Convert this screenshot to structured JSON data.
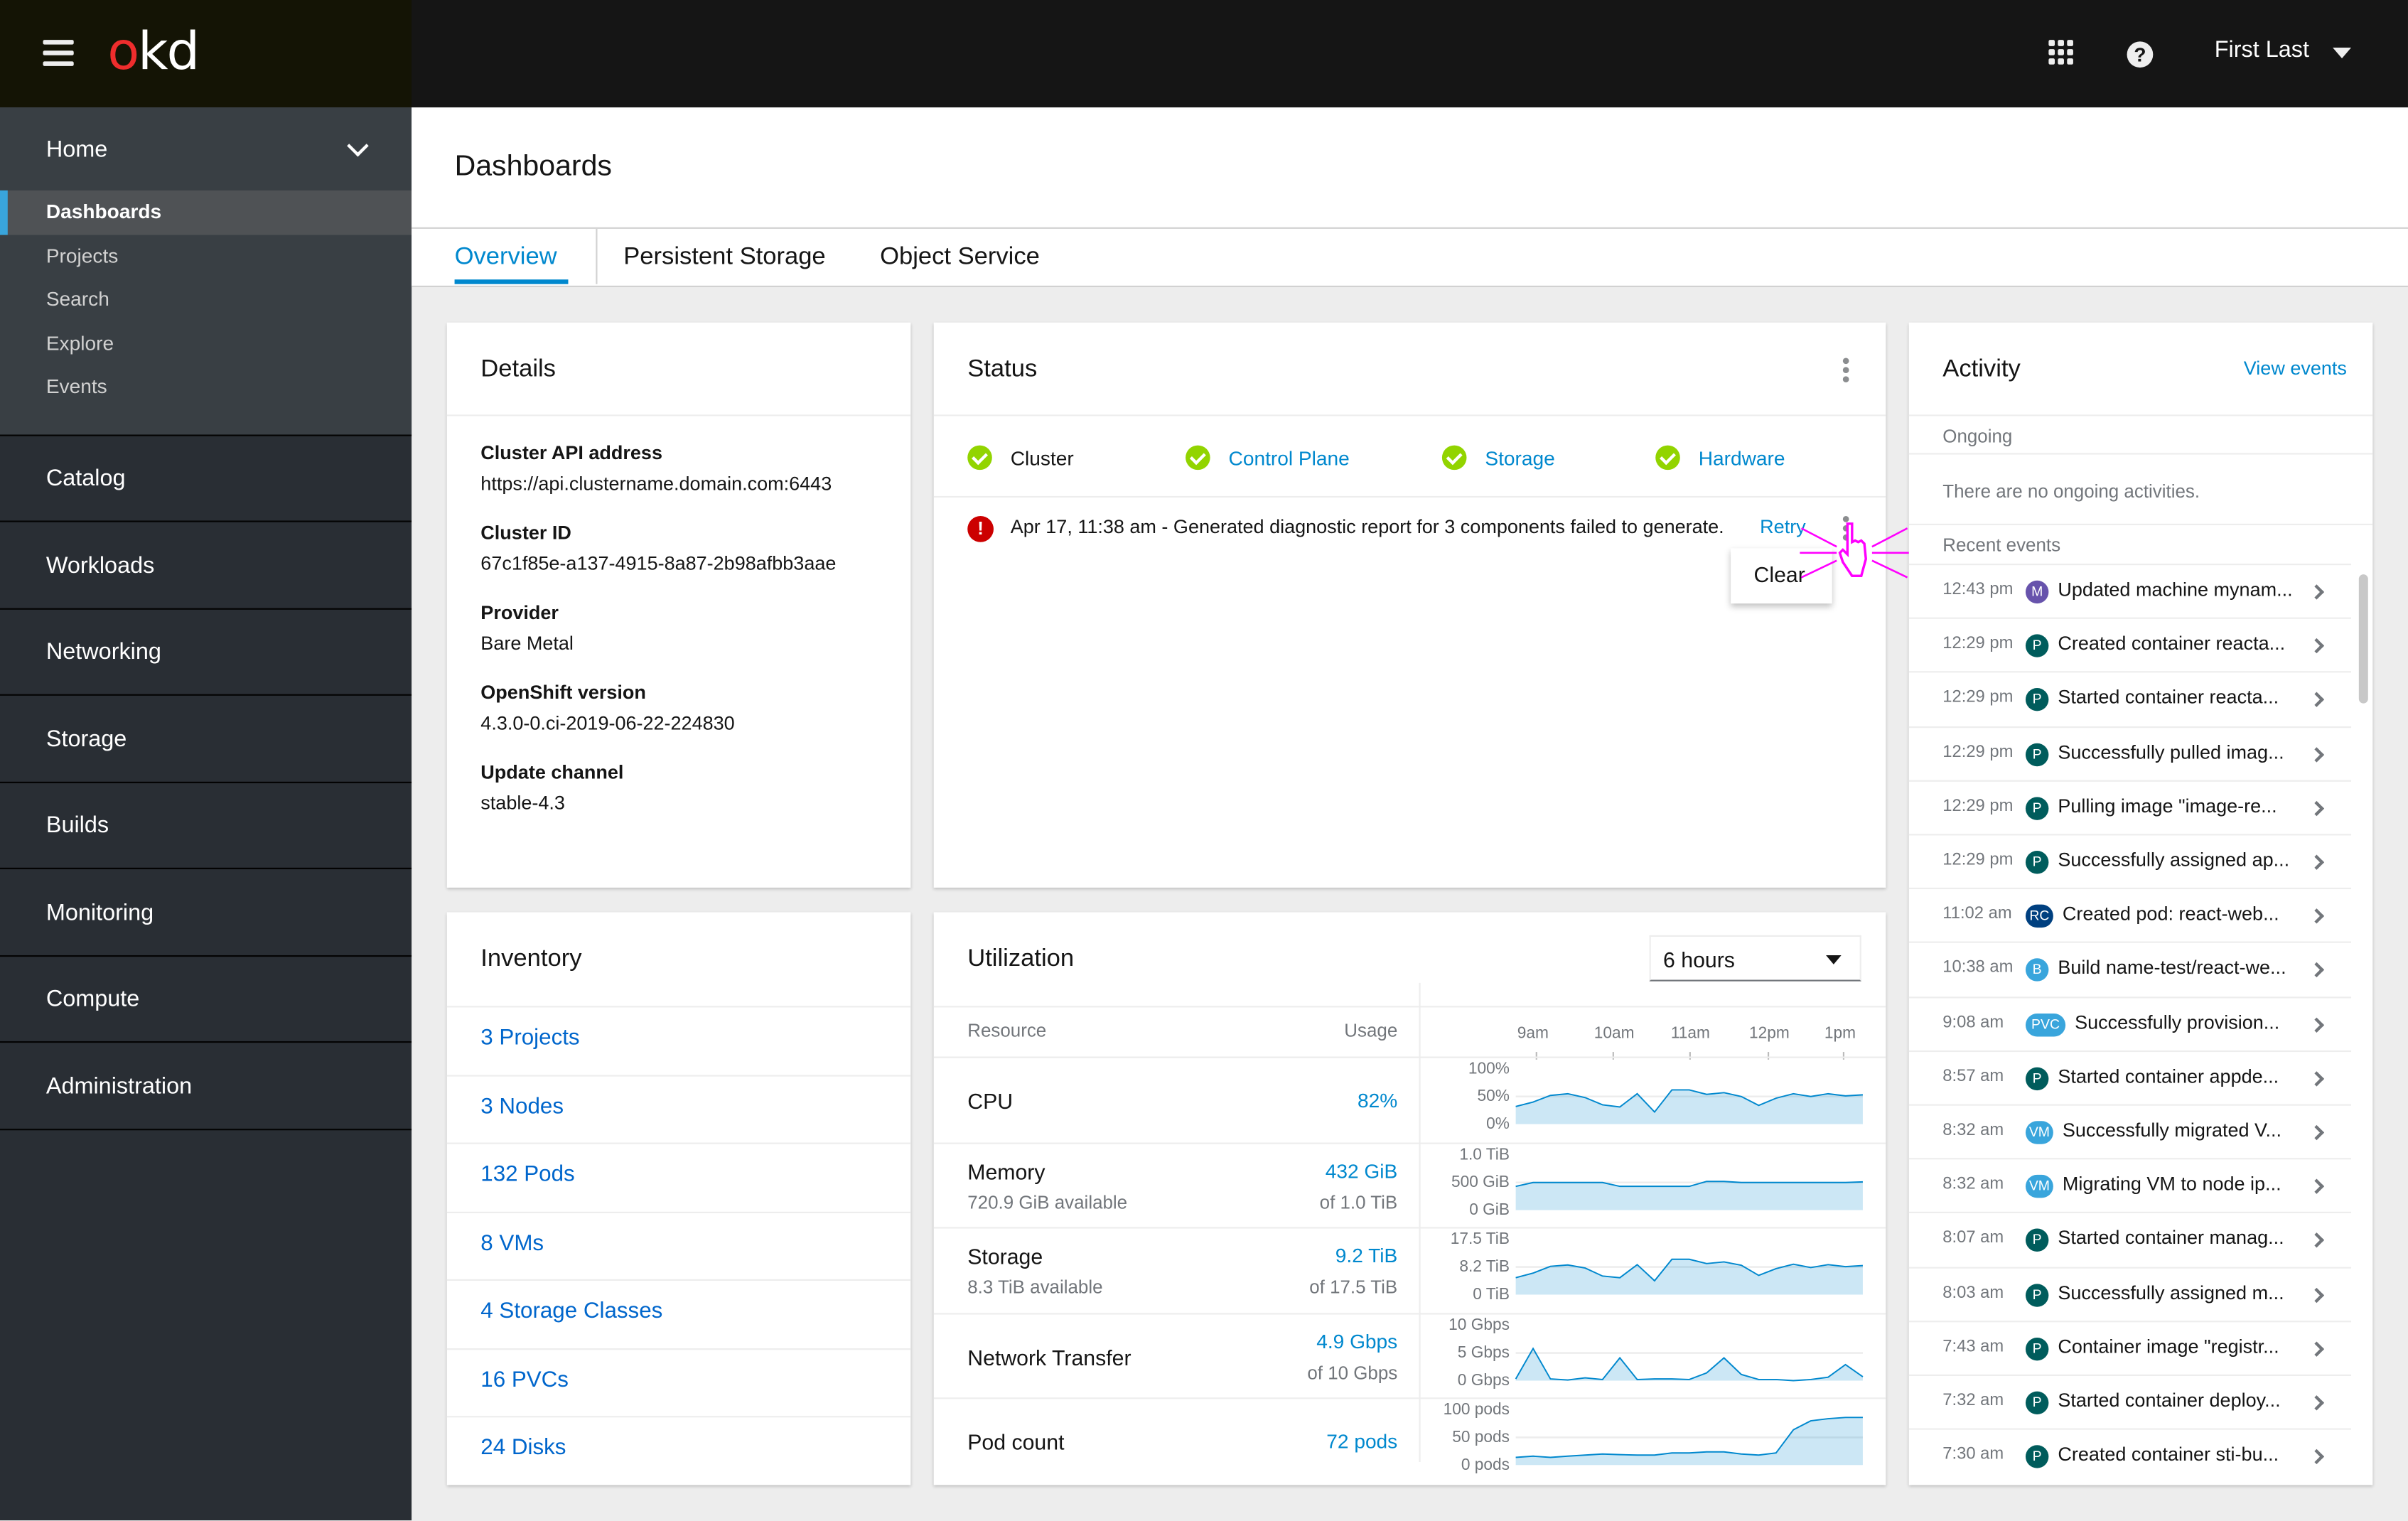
{
  "masthead": {
    "brand": {
      "o": "o",
      "kd": "kd"
    },
    "icons": [
      "hamburger-menu-icon",
      "app-launcher-grid-icon",
      "help-question-icon"
    ],
    "user_name": "First Last",
    "colors": {
      "logo_o": "#ee2d2d",
      "masthead_bg": "#151515"
    }
  },
  "sidebar": {
    "home": {
      "label": "Home",
      "expanded": true,
      "children": [
        {
          "label": "Dashboards",
          "active": true
        },
        {
          "label": "Projects"
        },
        {
          "label": "Search"
        },
        {
          "label": "Explore"
        },
        {
          "label": "Events"
        }
      ]
    },
    "items": [
      {
        "label": "Catalog"
      },
      {
        "label": "Workloads"
      },
      {
        "label": "Networking"
      },
      {
        "label": "Storage"
      },
      {
        "label": "Builds"
      },
      {
        "label": "Monitoring"
      },
      {
        "label": "Compute"
      },
      {
        "label": "Administration"
      }
    ]
  },
  "page": {
    "title": "Dashboards",
    "tabs": [
      {
        "label": "Overview",
        "active": true
      },
      {
        "label": "Persistent Storage"
      },
      {
        "label": "Object Service"
      }
    ]
  },
  "details": {
    "title": "Details",
    "fields": [
      {
        "label": "Cluster API address",
        "value": "https://api.clustername.domain.com:6443"
      },
      {
        "label": "Cluster ID",
        "value": "67c1f85e-a137-4915-8a87-2b98afbb3aae"
      },
      {
        "label": "Provider",
        "value": "Bare Metal"
      },
      {
        "label": "OpenShift version",
        "value": "4.3.0-0.ci-2019-06-22-224830"
      },
      {
        "label": "Update channel",
        "value": "stable-4.3"
      }
    ]
  },
  "status": {
    "title": "Status",
    "items": [
      {
        "label": "Cluster",
        "state": "ok",
        "link": false
      },
      {
        "label": "Control Plane",
        "state": "ok",
        "link": true
      },
      {
        "label": "Storage",
        "state": "ok",
        "link": true
      },
      {
        "label": "Hardware",
        "state": "ok",
        "link": true
      }
    ],
    "alert": {
      "severity": "error",
      "text": "Apr 17, 11:38 am - Generated diagnostic report for 3 components failed to generate.",
      "action": "Retry"
    },
    "menu": {
      "items": [
        "Clear"
      ]
    },
    "colors": {
      "ok": "#92d400",
      "error": "#cc0000",
      "link": "#0088ce"
    }
  },
  "activity": {
    "title": "Activity",
    "view_events": "View events",
    "ongoing_label": "Ongoing",
    "ongoing_empty": "There are no ongoing activities.",
    "recent_label": "Recent events",
    "events": [
      {
        "time": "12:43 pm",
        "badge": "M",
        "color": "#6753ac",
        "text": "Updated machine mynam..."
      },
      {
        "time": "12:29 pm",
        "badge": "P",
        "color": "#005c5c",
        "text": "Created container reacta..."
      },
      {
        "time": "12:29 pm",
        "badge": "P",
        "color": "#005c5c",
        "text": "Started container reacta..."
      },
      {
        "time": "12:29 pm",
        "badge": "P",
        "color": "#005c5c",
        "text": "Successfully pulled imag..."
      },
      {
        "time": "12:29 pm",
        "badge": "P",
        "color": "#005c5c",
        "text": "Pulling image \"image-re..."
      },
      {
        "time": "12:29 pm",
        "badge": "P",
        "color": "#005c5c",
        "text": "Successfully assigned ap..."
      },
      {
        "time": "11:02 am",
        "badge": "RC",
        "color": "#004080",
        "text": "Created pod: react-web..."
      },
      {
        "time": "10:38 am",
        "badge": "B",
        "color": "#39a5dc",
        "text": "Build name-test/react-we..."
      },
      {
        "time": "9:08 am",
        "badge": "PVC",
        "color": "#39a5dc",
        "text": "Successfully provision..."
      },
      {
        "time": "8:57 am",
        "badge": "P",
        "color": "#005c5c",
        "text": "Started container appde..."
      },
      {
        "time": "8:32 am",
        "badge": "VM",
        "color": "#39a5dc",
        "text": "Successfully migrated V..."
      },
      {
        "time": "8:32 am",
        "badge": "VM",
        "color": "#39a5dc",
        "text": "Migrating VM to node ip..."
      },
      {
        "time": "8:07 am",
        "badge": "P",
        "color": "#005c5c",
        "text": "Started container manag..."
      },
      {
        "time": "8:03 am",
        "badge": "P",
        "color": "#005c5c",
        "text": "Successfully assigned m..."
      },
      {
        "time": "7:43 am",
        "badge": "P",
        "color": "#005c5c",
        "text": "Container image \"registr..."
      },
      {
        "time": "7:32 am",
        "badge": "P",
        "color": "#005c5c",
        "text": "Started container deploy..."
      },
      {
        "time": "7:30 am",
        "badge": "P",
        "color": "#005c5c",
        "text": "Created container sti-bu..."
      }
    ]
  },
  "inventory": {
    "title": "Inventory",
    "items": [
      "3 Projects",
      "3 Nodes",
      "132 Pods",
      "8 VMs",
      "4 Storage Classes",
      "16 PVCs",
      "24 Disks"
    ]
  },
  "utilization": {
    "title": "Utilization",
    "range": "6 hours",
    "col_resource": "Resource",
    "col_usage": "Usage",
    "x_ticks": [
      "9am",
      "10am",
      "11am",
      "12pm",
      "1pm"
    ],
    "rows": [
      {
        "name": "CPU",
        "sub": "",
        "value": "82%",
        "of": ""
      },
      {
        "name": "Memory",
        "sub": "720.9 GiB available",
        "value": "432 GiB",
        "of": "of 1.0 TiB"
      },
      {
        "name": "Storage",
        "sub": "8.3 TiB available",
        "value": "9.2 TiB",
        "of": "of 17.5 TiB"
      },
      {
        "name": "Network Transfer",
        "sub": "",
        "value": "4.9 Gbps",
        "of": "of 10 Gbps"
      },
      {
        "name": "Pod count",
        "sub": "",
        "value": "72 pods",
        "of": ""
      }
    ]
  },
  "chart_data": [
    {
      "type": "area",
      "title": "CPU",
      "x": [
        "8:40am",
        "",
        "",
        "",
        "",
        "",
        "",
        "",
        "",
        "",
        "",
        "",
        "",
        "",
        "",
        "",
        "",
        "",
        "",
        "",
        "1:10pm"
      ],
      "y_ticks": [
        "100%",
        "50%",
        "0%"
      ],
      "ylim": [
        0,
        100
      ],
      "grid_line": 50,
      "values": [
        32,
        40,
        52,
        55,
        48,
        35,
        31,
        55,
        22,
        62,
        62,
        54,
        57,
        50,
        34,
        47,
        55,
        50,
        55,
        51,
        53
      ]
    },
    {
      "type": "area",
      "title": "Memory",
      "y_ticks": [
        "1.0 TiB",
        "500 GiB",
        "0 GiB"
      ],
      "ylim": [
        0,
        1000
      ],
      "grid_line": 500,
      "values": [
        430,
        500,
        500,
        500,
        500,
        500,
        430,
        430,
        430,
        430,
        430,
        520,
        520,
        500,
        500,
        500,
        500,
        500,
        500,
        500,
        510
      ]
    },
    {
      "type": "area",
      "title": "Storage",
      "y_ticks": [
        "17.5 TiB",
        "8.2 TiB",
        "0 TiB"
      ],
      "ylim": [
        0,
        16.4
      ],
      "grid_line": 8.2,
      "values": [
        5,
        6.4,
        8.4,
        8.8,
        7.9,
        5.5,
        5,
        8.9,
        4.1,
        10.5,
        10.5,
        9.2,
        9.7,
        8.7,
        5.7,
        7.7,
        9,
        8,
        8.9,
        8.3,
        8.6
      ]
    },
    {
      "type": "area",
      "title": "Network Transfer",
      "y_ticks": [
        "10 Gbps",
        "5 Gbps",
        "0 Gbps"
      ],
      "ylim": [
        0,
        10
      ],
      "grid_line": 5,
      "values": [
        0.3,
        5.8,
        0.3,
        0.1,
        0.5,
        0.2,
        4.1,
        0.2,
        0.3,
        0.3,
        0.2,
        1.4,
        4.1,
        1.1,
        0.2,
        0.2,
        0,
        0.2,
        0.6,
        2.9,
        0.7
      ]
    },
    {
      "type": "area",
      "title": "Pod count",
      "y_ticks": [
        "100 pods",
        "50 pods",
        "0 pods"
      ],
      "ylim": [
        0,
        100
      ],
      "grid_line": 50,
      "values": [
        14,
        16,
        14,
        16,
        18,
        20,
        19,
        18,
        18,
        22,
        22,
        24,
        24,
        20,
        18,
        22,
        64,
        80,
        84,
        86,
        86
      ]
    }
  ]
}
